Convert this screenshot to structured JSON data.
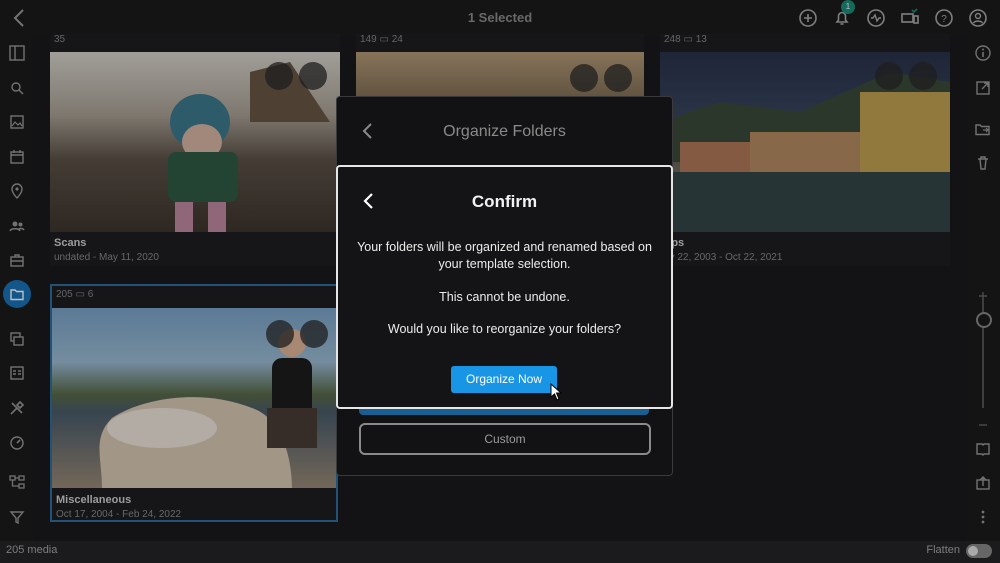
{
  "header": {
    "title": "1 Selected",
    "notification_count": "1"
  },
  "cards": [
    {
      "count": "35",
      "folders": "",
      "name": "Scans",
      "date": "undated - May 11, 2020"
    },
    {
      "count": "149",
      "folders": "24",
      "name": "",
      "date": ""
    },
    {
      "count": "248",
      "folders": "13",
      "name": "rips",
      "date": "ov 22, 2003 - Oct 22, 2021"
    },
    {
      "count": "205",
      "folders": "6",
      "name": "Miscellaneous",
      "date": "Oct 17, 2004 - Feb 24, 2022"
    }
  ],
  "organize_dialog": {
    "title": "Organize Folders",
    "custom_label": "Custom"
  },
  "confirm_dialog": {
    "title": "Confirm",
    "message_1": "Your folders will be organized and renamed based on your template selection.",
    "message_2": "This cannot be undone.",
    "message_3": "Would you like to reorganize your folders?",
    "button_label": "Organize Now"
  },
  "footer": {
    "media_count": "205 media",
    "flatten_label": "Flatten"
  },
  "colors": {
    "accent": "#1995e6",
    "active_nav": "#1a73b8",
    "badge": "#1d8f7a"
  },
  "icons": {
    "left_nav": [
      "sidebar-toggle-icon",
      "search-icon",
      "image-icon",
      "calendar-icon",
      "location-icon",
      "people-icon",
      "briefcase-icon",
      "folder-icon",
      "stack-icon",
      "list-layout-icon",
      "tools-icon",
      "gauge-icon",
      "hierarchy-icon",
      "filter-icon"
    ],
    "right_nav": [
      "info-icon",
      "open-external-icon",
      "move-folder-icon",
      "trash-icon",
      "zoom-in-icon",
      "zoom-out-icon",
      "book-icon",
      "upload-icon",
      "more-icon"
    ]
  }
}
